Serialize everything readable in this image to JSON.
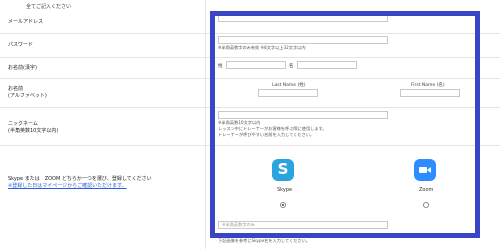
{
  "top_note": "全てご記入ください",
  "rows": {
    "email": {
      "label": "メールアドレス"
    },
    "password": {
      "label": "パスワード",
      "hint": "※半角英数字のみ有効 ※8文字以上32文字以内"
    },
    "name_kanji": {
      "label": "お名前(漢字)",
      "last_prefix": "姓",
      "first_prefix": "名"
    },
    "name_alpha": {
      "label": "お名前",
      "label_sub": "(アルファベット)",
      "last_header": "Last Name (姓)",
      "first_header": "First Name (名)"
    },
    "nickname": {
      "label": "ニックネーム",
      "label_sub": "(半角英数10文字以内)",
      "hints": [
        "※半角英数10文字以内",
        "レッスン中にトレーナーがお客様を呼ぶ際に使用します。",
        "トレーナーが呼びやすい名前を入力してください。"
      ]
    },
    "contact": {
      "label": "Skype または　ZOOM どちらか一つを選び、登録してください",
      "link_text": "※登録した日はマイページからご確認いただけます。",
      "options": [
        {
          "name": "Skype",
          "icon": "skype-icon",
          "selected": true
        },
        {
          "name": "Zoom",
          "icon": "zoom-icon",
          "selected": false
        }
      ],
      "skype_hint": "※半角英数字のみ",
      "skype_note": "下記画像を参考にSkype名を入力してください。"
    }
  },
  "colors": {
    "highlight_border": "#3a44c6",
    "skype": "#2ba3df",
    "zoom": "#2d8cff",
    "link": "#2b5fd9"
  }
}
